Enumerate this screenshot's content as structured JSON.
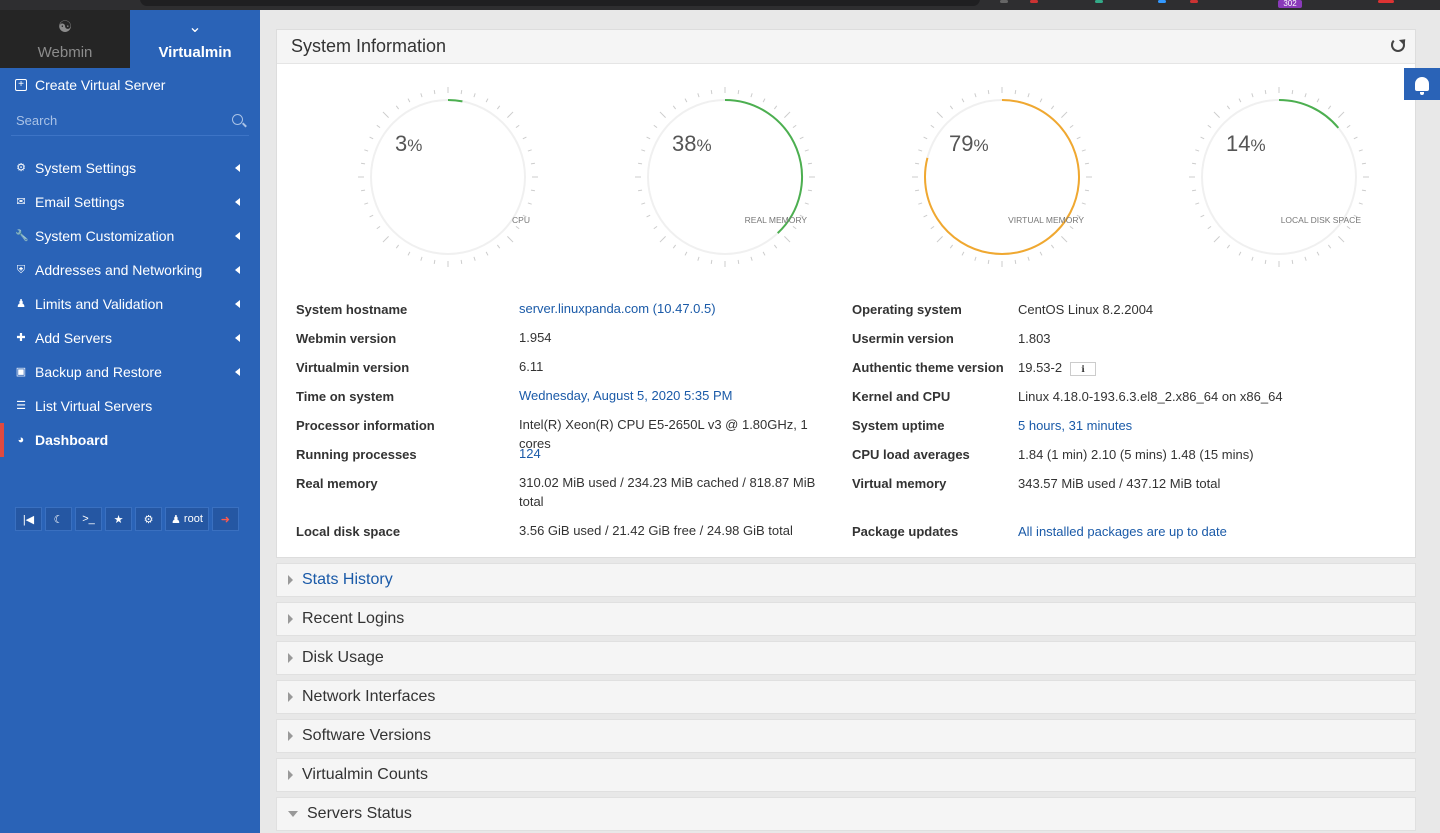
{
  "browser": {
    "notification_count": "302"
  },
  "switcher": {
    "webmin_label": "Webmin",
    "virtualmin_label": "Virtualmin"
  },
  "sidebar": {
    "create_label": "Create Virtual Server",
    "search_placeholder": "Search",
    "items": [
      {
        "label": "System Settings",
        "icon": "gear-icon"
      },
      {
        "label": "Email Settings",
        "icon": "envelope-icon"
      },
      {
        "label": "System Customization",
        "icon": "wrench-icon"
      },
      {
        "label": "Addresses and Networking",
        "icon": "shield-icon"
      },
      {
        "label": "Limits and Validation",
        "icon": "user-icon"
      },
      {
        "label": "Add Servers",
        "icon": "plus-icon"
      },
      {
        "label": "Backup and Restore",
        "icon": "save-icon"
      },
      {
        "label": "List Virtual Servers",
        "icon": "list-icon"
      },
      {
        "label": "Dashboard",
        "icon": "dashboard-icon"
      }
    ],
    "user_label": "root"
  },
  "panel": {
    "title": "System Information"
  },
  "gauges": [
    {
      "value": "3",
      "unit": "%",
      "label": "CPU",
      "percent": 3,
      "color": "#4caf50"
    },
    {
      "value": "38",
      "unit": "%",
      "label": "REAL MEMORY",
      "percent": 38,
      "color": "#4caf50"
    },
    {
      "value": "79",
      "unit": "%",
      "label": "VIRTUAL MEMORY",
      "percent": 79,
      "color": "#f0a830"
    },
    {
      "value": "14",
      "unit": "%",
      "label": "LOCAL DISK SPACE",
      "percent": 14,
      "color": "#4caf50"
    }
  ],
  "info": {
    "hostname_k": "System hostname",
    "hostname_v": "server.linuxpanda.com (10.47.0.5)",
    "os_k": "Operating system",
    "os_v": "CentOS Linux 8.2.2004",
    "webmin_k": "Webmin version",
    "webmin_v": "1.954",
    "usermin_k": "Usermin version",
    "usermin_v": "1.803",
    "virtualmin_k": "Virtualmin version",
    "virtualmin_v": "6.11",
    "theme_k": "Authentic theme version",
    "theme_v": "19.53-2",
    "time_k": "Time on system",
    "time_v": "Wednesday, August 5, 2020 5:35 PM",
    "kernel_k": "Kernel and CPU",
    "kernel_v": "Linux 4.18.0-193.6.3.el8_2.x86_64 on x86_64",
    "proc_k": "Processor information",
    "proc_v": "Intel(R) Xeon(R) CPU E5-2650L v3 @ 1.80GHz, 1 cores",
    "uptime_k": "System uptime",
    "uptime_v": "5 hours, 31 minutes",
    "running_k": "Running processes",
    "running_v": "124",
    "load_k": "CPU load averages",
    "load_v": "1.84 (1 min) 2.10 (5 mins) 1.48 (15 mins)",
    "realmem_k": "Real memory",
    "realmem_v": "310.02 MiB used / 234.23 MiB cached / 818.87 MiB total",
    "virtmem_k": "Virtual memory",
    "virtmem_v": "343.57 MiB used / 437.12 MiB total",
    "disk_k": "Local disk space",
    "disk_v": "3.56 GiB used / 21.42 GiB free / 24.98 GiB total",
    "pkg_k": "Package updates",
    "pkg_v": "All installed packages are up to date"
  },
  "accordion": {
    "stats": "Stats History",
    "logins": "Recent Logins",
    "disk": "Disk Usage",
    "network": "Network Interfaces",
    "software": "Software Versions",
    "counts": "Virtualmin Counts",
    "servers": "Servers Status"
  }
}
